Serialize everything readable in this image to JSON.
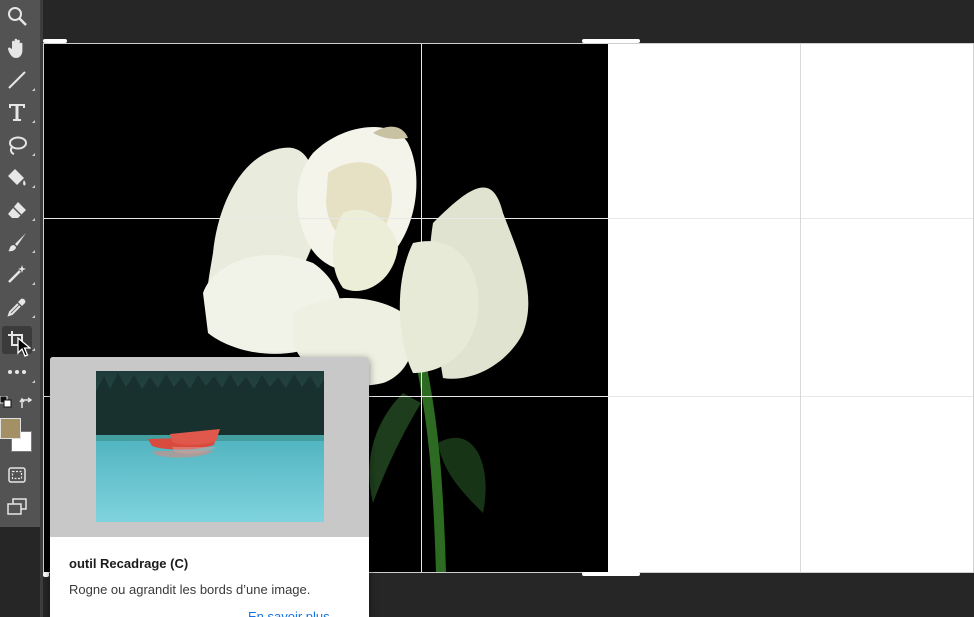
{
  "toolbar": {
    "tools": [
      {
        "name": "zoom-tool",
        "icon": "magnifier-icon"
      },
      {
        "name": "hand-tool",
        "icon": "hand-icon"
      },
      {
        "name": "line-tool",
        "icon": "line-icon"
      },
      {
        "name": "type-tool",
        "icon": "type-icon"
      },
      {
        "name": "lasso-tool",
        "icon": "lasso-icon"
      },
      {
        "name": "paint-bucket-tool",
        "icon": "paint-bucket-icon"
      },
      {
        "name": "eraser-tool",
        "icon": "eraser-icon"
      },
      {
        "name": "brush-tool",
        "icon": "brush-icon"
      },
      {
        "name": "magic-wand-tool",
        "icon": "magic-wand-icon"
      },
      {
        "name": "eyedropper-tool",
        "icon": "eyedropper-icon"
      },
      {
        "name": "crop-tool",
        "icon": "crop-icon",
        "active": true
      },
      {
        "name": "more-tools",
        "icon": "ellipsis-icon"
      }
    ],
    "foreground_color": "#a39065",
    "background_color": "#ffffff"
  },
  "tooltip": {
    "title": "outil Recadrage (C)",
    "description": "Rogne ou agrandit les bords d’une image.",
    "link": "En savoir plus"
  },
  "colors": {
    "toolbar": "#535353",
    "workspace": "#262626",
    "link": "#1473e6"
  }
}
